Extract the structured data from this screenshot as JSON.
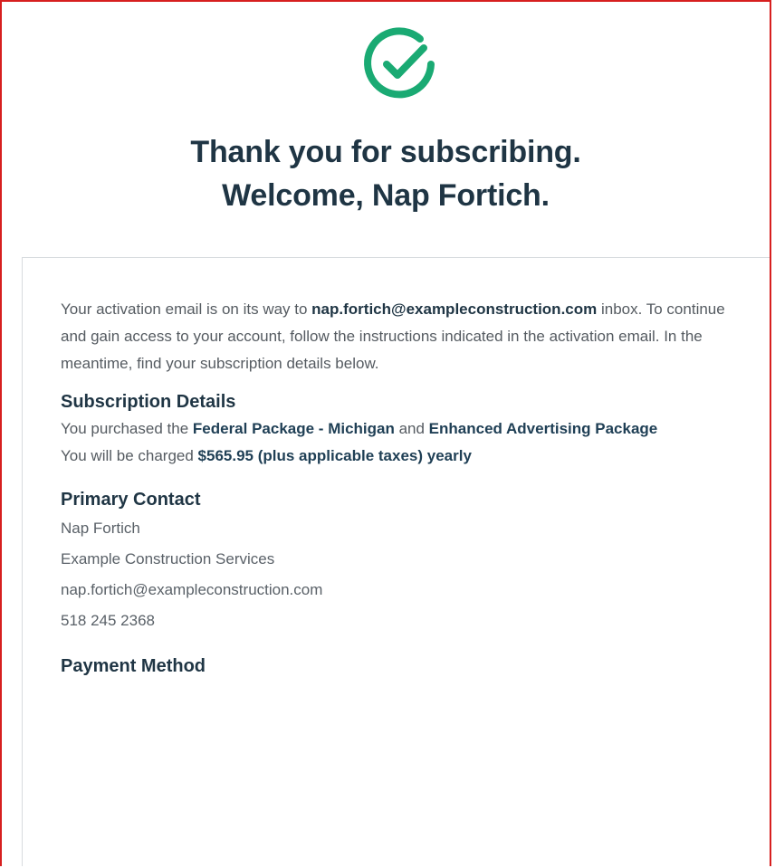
{
  "header": {
    "title_line1": "Thank you for subscribing.",
    "title_line2": "Welcome, Nap Fortich.",
    "icon": "check-circle-icon",
    "icon_color": "#1aaa73"
  },
  "intro": {
    "prefix": "Your activation email is on its way to ",
    "email": "nap.fortich@exampleconstruction.com",
    "suffix": " inbox. To continue and gain access to your account, follow the instructions indicated in the activation email. In the meantime, find your subscription details below."
  },
  "subscription": {
    "heading": "Subscription Details",
    "purchase_prefix": "You purchased the ",
    "package_one": "Federal Package - Michigan",
    "purchase_joiner": " and ",
    "package_two": "Enhanced Advertising Package",
    "charge_prefix": "You will be charged ",
    "charge_value": "$565.95 (plus applicable taxes) yearly"
  },
  "contact": {
    "heading": "Primary Contact",
    "name": "Nap Fortich",
    "company": "Example Construction Services",
    "email": "nap.fortich@exampleconstruction.com",
    "phone": "518 245 2368"
  },
  "payment": {
    "heading": "Payment Method"
  },
  "colors": {
    "heading": "#1f3544",
    "text": "#555b61",
    "border": "#d71f1f"
  }
}
